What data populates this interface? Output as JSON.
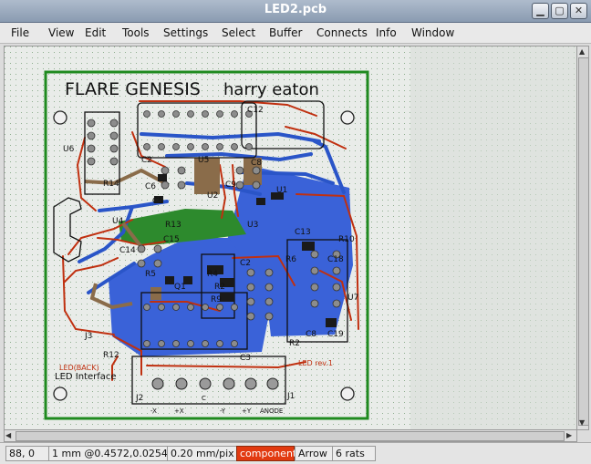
{
  "window": {
    "title": "LED2.pcb"
  },
  "menu": [
    "File",
    "View",
    "Edit",
    "Tools",
    "Settings",
    "Select",
    "Buffer",
    "Connects",
    "Info",
    "Window"
  ],
  "board": {
    "title": "FLARE GENESIS",
    "author": "harry eaton",
    "led_label": "LED Interface",
    "led_small": "LED(BACK)",
    "led_rev": "LED rev.1",
    "components": [
      "U6",
      "C12",
      "C2",
      "U5",
      "C8",
      "R14",
      "C6",
      "C9",
      "C5",
      "U2",
      "U1",
      "R13",
      "U4",
      "U3",
      "C13",
      "C15",
      "C14",
      "R10",
      "C18",
      "R5",
      "R4",
      "C2",
      "R6",
      "Q1",
      "R2",
      "R9",
      "U7",
      "C8",
      "C19",
      "J3",
      "R12",
      "R2",
      "C3",
      "J2",
      "J1"
    ],
    "pin_labels": [
      "-X",
      "+X",
      "C",
      "-Y",
      "+Y",
      "ANODE"
    ],
    "colors": {
      "board_outline": "#1f8a1f",
      "copper_top": "#c03010",
      "copper_bottom": "#2a55c8",
      "silk": "#101010",
      "ground_plane": "#3a62d8",
      "pad": "#888888"
    }
  },
  "status": {
    "cursor": "88, 0",
    "grid": "1 mm @0.4572,0.0254",
    "zoom": "0.20 mm/pix",
    "layer": "component",
    "mode": "Arrow",
    "rats": "6 rats"
  }
}
